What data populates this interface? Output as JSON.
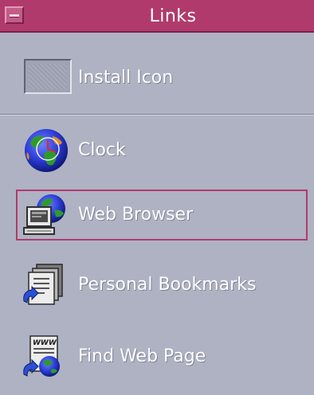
{
  "window": {
    "title": "Links"
  },
  "items": [
    {
      "label": "Install Icon",
      "icon": "install-drop-target-icon"
    },
    {
      "label": "Clock",
      "icon": "clock-globe-icon"
    },
    {
      "label": "Web Browser",
      "icon": "web-browser-icon",
      "selected": true
    },
    {
      "label": "Personal Bookmarks",
      "icon": "bookmarks-icon"
    },
    {
      "label": "Find Web Page",
      "icon": "find-web-page-icon"
    }
  ],
  "colors": {
    "titlebar": "#b13a6c",
    "panel_background": "#aeb2c3",
    "selection_border": "#b13a6c",
    "label_text": "#ffffff"
  }
}
